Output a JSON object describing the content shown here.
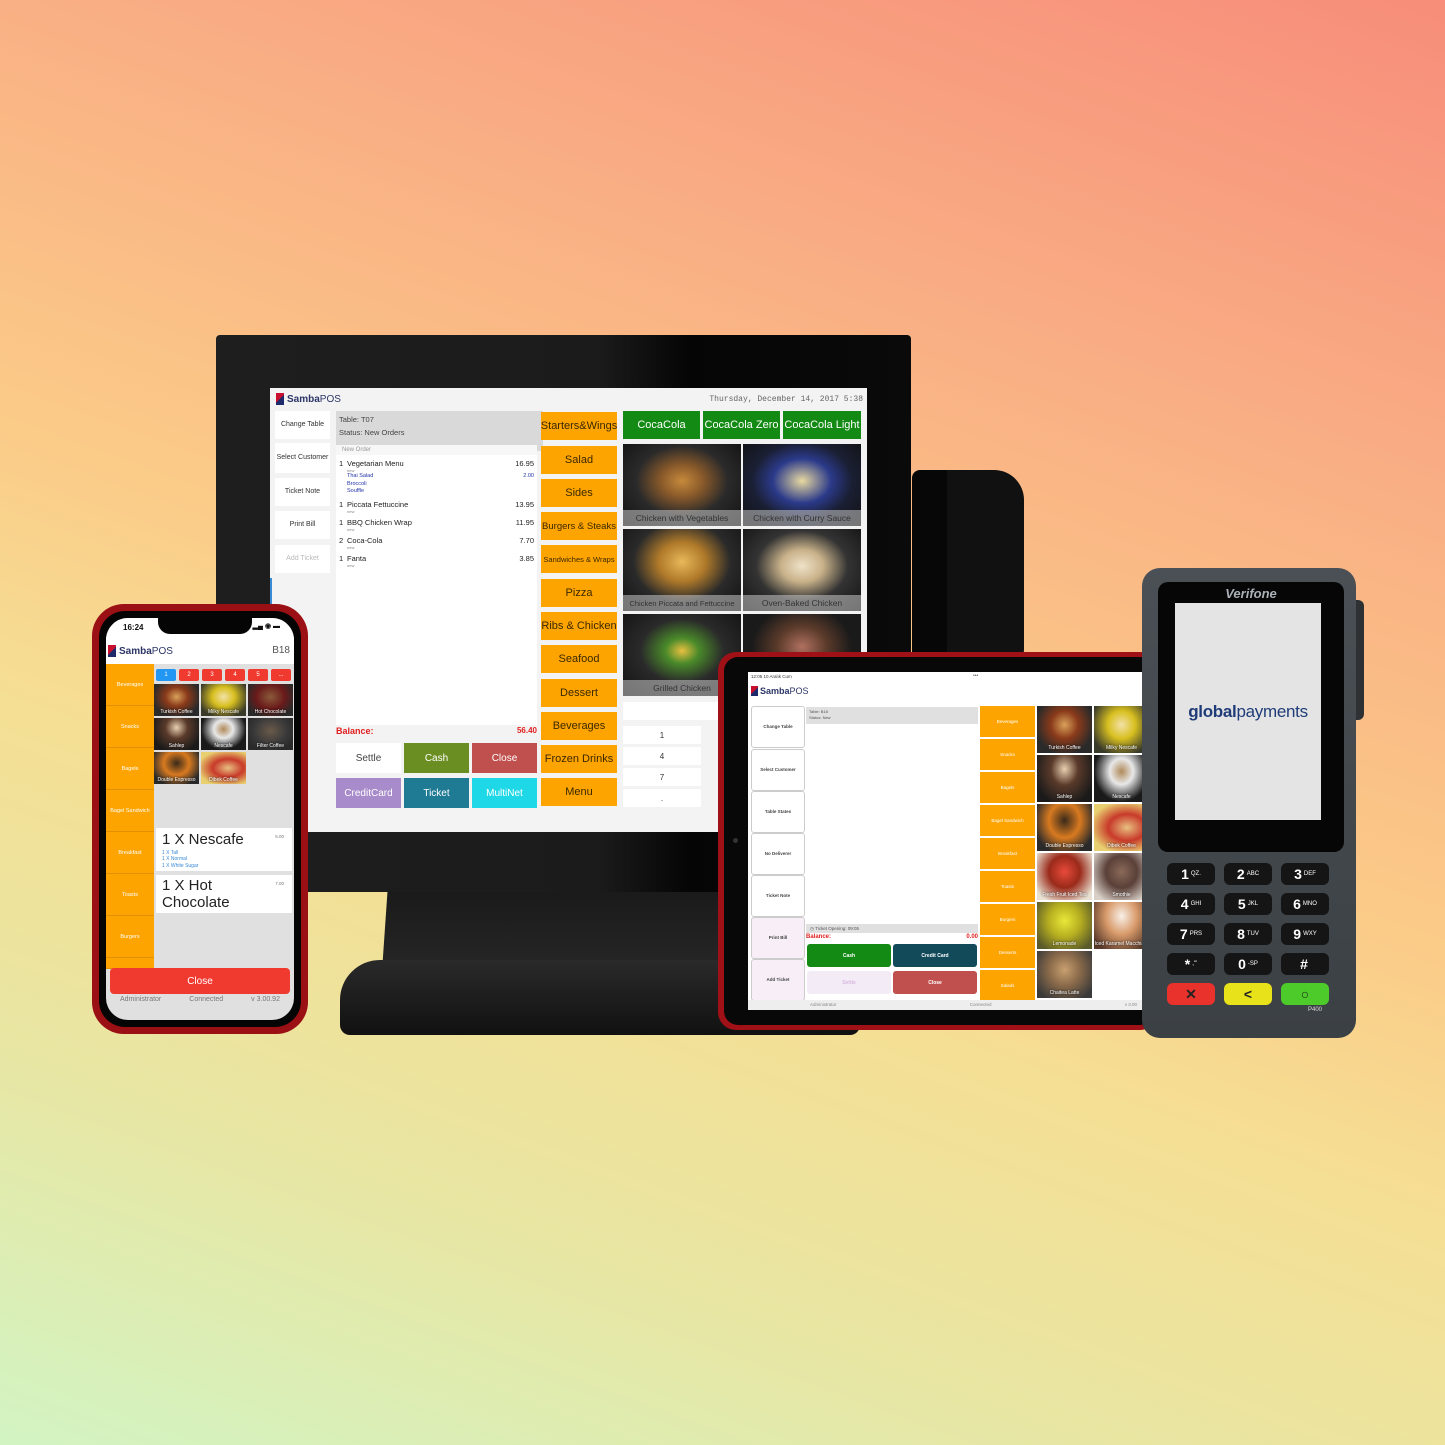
{
  "monitor": {
    "brand": {
      "bold": "Samba",
      "light": "POS"
    },
    "datetime": "Thursday, December 14, 2017 5:38",
    "side_buttons": [
      "Change Table",
      "Select Customer",
      "Ticket Note",
      "Print Bill",
      "Add Ticket"
    ],
    "ticket": {
      "table": "Table: T07",
      "status": "Status: New Orders",
      "section": "New Order",
      "new_tag": "new",
      "items": [
        {
          "qty": "1",
          "name": "Vegetarian Menu",
          "price": "16.95"
        },
        {
          "qty": "1",
          "name": "Piccata Fettuccine",
          "price": "13.95"
        },
        {
          "qty": "1",
          "name": "BBQ Chicken Wrap",
          "price": "11.95"
        },
        {
          "qty": "2",
          "name": "Coca-Cola",
          "price": "7.70"
        },
        {
          "qty": "1",
          "name": "Fanta",
          "price": "3.85"
        }
      ],
      "modifiers": [
        {
          "name": "Thai Salad",
          "price": "2.00"
        },
        {
          "name": "Broccoli",
          "price": ""
        },
        {
          "name": "Souffle",
          "price": ""
        }
      ]
    },
    "balance_label": "Balance:",
    "balance_value": "56.40",
    "payment_buttons": [
      {
        "label": "Settle",
        "color": "#ffffff"
      },
      {
        "label": "Cash",
        "color": "#6b8e23"
      },
      {
        "label": "Close",
        "color": "#c0504d"
      },
      {
        "label": "CreditCard",
        "color": "#a88bcb"
      },
      {
        "label": "Ticket",
        "color": "#1f7a94"
      },
      {
        "label": "MultiNet",
        "color": "#1ed8e8"
      }
    ],
    "categories": [
      "Starters&Wings",
      "Salad",
      "Sides",
      "Burgers & Steaks",
      "Sandwiches & Wraps",
      "Pizza",
      "Ribs & Chicken",
      "Seafood",
      "Dessert",
      "Beverages",
      "Frozen Drinks",
      "Menu"
    ],
    "drinks": [
      "CocaCola",
      "CocaCola Zero",
      "CocaCola Light"
    ],
    "foods": [
      "Chicken with Vegetables",
      "Chicken with Curry Sauce",
      "Chicken Piccata and Fettuccine",
      "Oven-Baked Chicken",
      "Grilled Chicken",
      ""
    ],
    "numpad": [
      "1",
      "4",
      "7",
      "."
    ]
  },
  "phone": {
    "time": "16:24",
    "brand": {
      "bold": "Samba",
      "light": "POS"
    },
    "table": "B18",
    "categories": [
      "Beverages",
      "Snacks",
      "Bagels",
      "Bagel Sandwich",
      "Breakfast",
      "Toasts",
      "Burgers"
    ],
    "ticket_tabs": [
      "1",
      "2",
      "3",
      "4",
      "5",
      "..."
    ],
    "products": [
      "Turkish Coffee",
      "Milky Nescafe",
      "Hot Chocolate",
      "Sahlep",
      "Nescafe",
      "Filter Coffee",
      "Double Espresso",
      "Dibek Coffee"
    ],
    "orders": [
      {
        "title": "1 X Nescafe",
        "price": "5.00",
        "modifiers": [
          "1 X Tall",
          "1 X Normal",
          "1 X White Sugar"
        ]
      },
      {
        "title": "1 X Hot Chocolate",
        "price": "7.00",
        "modifiers": []
      }
    ],
    "close_label": "Close",
    "footer": {
      "user": "Administrator",
      "status": "Connected",
      "version": "v 3.00.92"
    }
  },
  "tablet": {
    "status_bar": "12:05  10 Aralık Cum",
    "more": "•••",
    "brand": {
      "bold": "Samba",
      "light": "POS"
    },
    "table": "Table: B18",
    "status": "Status: New",
    "side_buttons": [
      "Change Table",
      "Select Customer",
      "Table States",
      "No Deliverer",
      "Ticket Note",
      "Print Bill",
      "Add Ticket"
    ],
    "ticket_opening": "Ticket Opening: 09:05",
    "balance_label": "Balance:",
    "balance_value": "0.00",
    "buttons": [
      {
        "label": "Cash",
        "color": "#138a13"
      },
      {
        "label": "Credit Card",
        "color": "#124a5a"
      },
      {
        "label": "Settle",
        "color": "#f3ecf6"
      },
      {
        "label": "Close",
        "color": "#c0504d"
      }
    ],
    "categories": [
      "Beverages",
      "Snacks",
      "Bagels",
      "Bagel Sandwich",
      "Breakfast",
      "Toasts",
      "Burgers",
      "Desserts",
      "Salads"
    ],
    "products": [
      "Turkish Coffee",
      "Milky Nescafe",
      "Sahlep",
      "Nescafe",
      "Double Espresso",
      "Dibek Coffee",
      "Fresh Fruit Iced Tea",
      "Smothie",
      "Lemonade",
      "Iced Karamel Macchiato",
      "Chaitea Latte"
    ],
    "footer": {
      "user": "Administrator",
      "status": "Connected",
      "version": "v 3.00"
    }
  },
  "terminal": {
    "brand": "Verifone",
    "screen_logo": {
      "bold": "global",
      "light": "payments"
    },
    "model": "P400",
    "keys": [
      {
        "d": "1",
        "l": "QZ."
      },
      {
        "d": "2",
        "l": "ABC"
      },
      {
        "d": "3",
        "l": "DEF"
      },
      {
        "d": "4",
        "l": "GHI"
      },
      {
        "d": "5",
        "l": "JKL"
      },
      {
        "d": "6",
        "l": "MNO"
      },
      {
        "d": "7",
        "l": "PRS"
      },
      {
        "d": "8",
        "l": "TUV"
      },
      {
        "d": "9",
        "l": "WXY"
      },
      {
        "d": "*",
        "l": ",'\""
      },
      {
        "d": "0",
        "l": "-SP"
      },
      {
        "d": "#",
        "l": ""
      }
    ],
    "function_keys": [
      {
        "symbol": "✕",
        "color": "#e8322b"
      },
      {
        "symbol": "<",
        "color": "#e8e21a"
      },
      {
        "symbol": "○",
        "color": "#4ccb2a"
      }
    ]
  },
  "colors": {
    "category_orange": "#fda400",
    "brand_navy": "#2c3566",
    "balance_red": "#e02020"
  }
}
